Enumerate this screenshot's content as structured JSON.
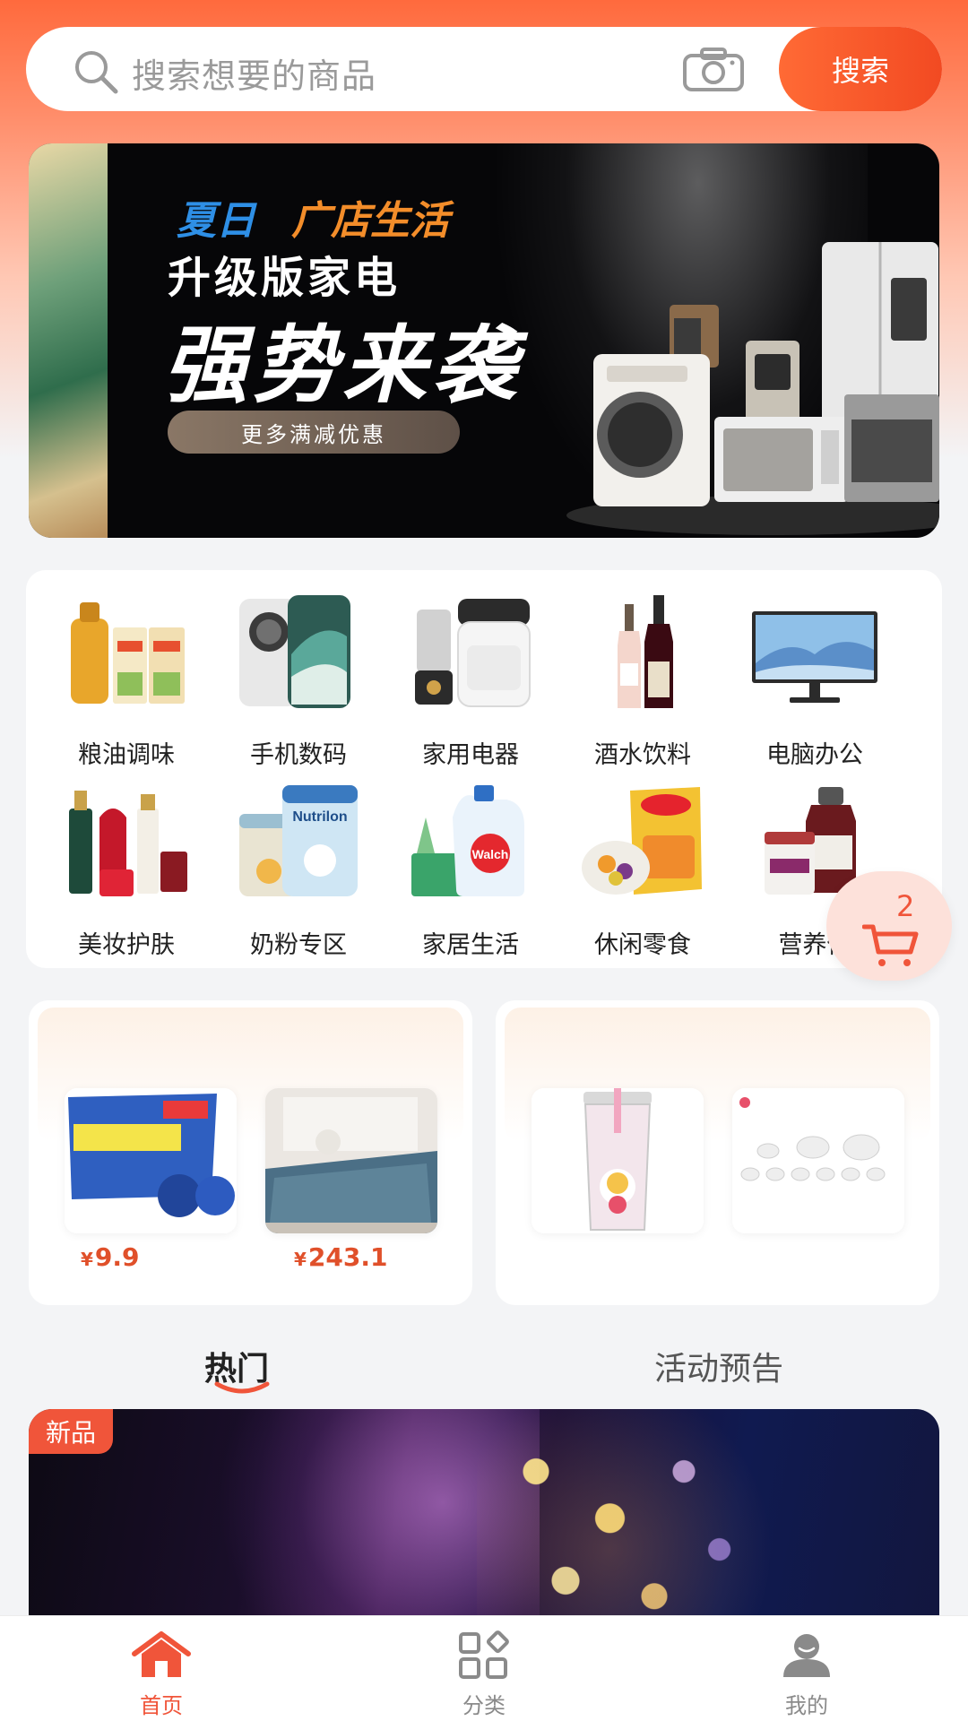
{
  "search": {
    "placeholder": "搜索想要的商品",
    "button_label": "搜索"
  },
  "banner": {
    "summer": "夏日",
    "store": "广店生活",
    "subtitle": "升级版家电",
    "headline": "强势来袭",
    "cta": "更多满减优惠"
  },
  "categories": [
    {
      "label": "粮油调味",
      "icon": "cooking-oil-rice"
    },
    {
      "label": "手机数码",
      "icon": "smartphone"
    },
    {
      "label": "家用电器",
      "icon": "blender-airfryer"
    },
    {
      "label": "酒水饮料",
      "icon": "wine-bottles"
    },
    {
      "label": "电脑办公",
      "icon": "monitor"
    },
    {
      "label": "美妆护肤",
      "icon": "cosmetics"
    },
    {
      "label": "奶粉专区",
      "icon": "milk-powder"
    },
    {
      "label": "家居生活",
      "icon": "detergent"
    },
    {
      "label": "休闲零食",
      "icon": "snacks"
    },
    {
      "label": "营养保",
      "icon": "supplements"
    }
  ],
  "cart": {
    "count": "2"
  },
  "promos": {
    "left": {
      "items": [
        {
          "name": "toilet-cleaner",
          "price": "9.9"
        },
        {
          "name": "blanket",
          "price": "243.1"
        }
      ],
      "currency": "¥"
    },
    "right": {
      "items": [
        {
          "name": "cup"
        },
        {
          "name": "tea-set"
        }
      ]
    }
  },
  "tabs": {
    "hot": "热门",
    "preview": "活动预告"
  },
  "feature": {
    "badge": "新品"
  },
  "nav": {
    "home": "首页",
    "category": "分类",
    "mine": "我的"
  },
  "colors": {
    "accent": "#f0553a",
    "search_button": "#f24a22",
    "price": "#e0502a"
  }
}
